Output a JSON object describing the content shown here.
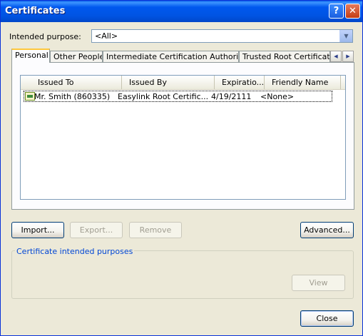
{
  "window": {
    "title": "Certificates",
    "help_label": "?",
    "close_label": "✕"
  },
  "purpose": {
    "label": "Intended purpose:",
    "value": "<All>"
  },
  "tabs": [
    {
      "label": "Personal"
    },
    {
      "label": "Other People"
    },
    {
      "label": "Intermediate Certification Authorities"
    },
    {
      "label": "Trusted Root Certification Authorities"
    }
  ],
  "tab_scroll": {
    "left": "◀",
    "right": "▶"
  },
  "list": {
    "columns": [
      "Issued To",
      "Issued By",
      "Expiratio...",
      "Friendly Name"
    ],
    "rows": [
      {
        "issued_to": "Mr. Smith (860335)",
        "issued_by": "Easylink Root Certific...",
        "expiration": "4/19/2111",
        "friendly_name": "<None>"
      }
    ]
  },
  "buttons": {
    "import": "Import...",
    "export": "Export...",
    "remove": "Remove",
    "advanced": "Advanced...",
    "view": "View",
    "close": "Close"
  },
  "group": {
    "title": "Certificate intended purposes"
  },
  "colors": {
    "titlebar": "#0054E3",
    "dialog_bg": "#ECE9D8",
    "group_title": "#0046D5"
  }
}
